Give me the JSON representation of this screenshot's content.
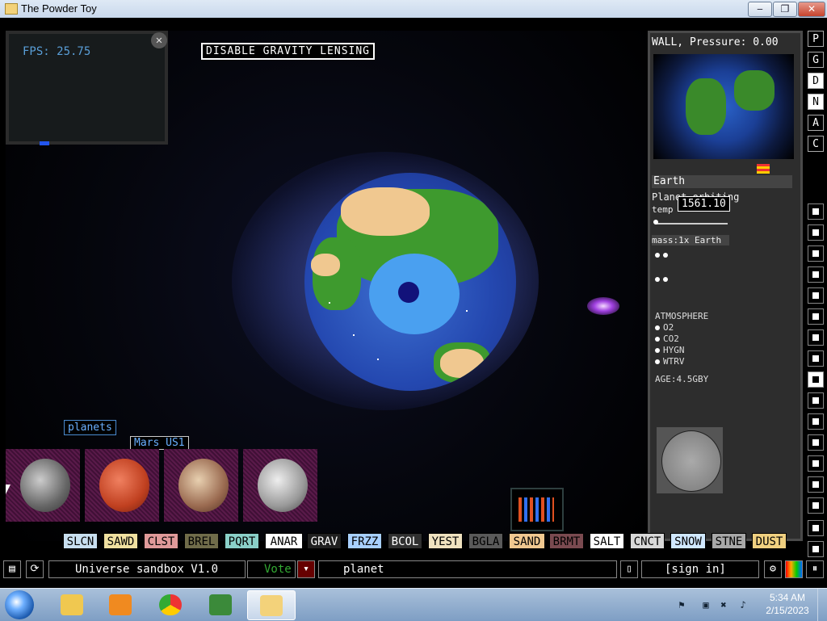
{
  "window": {
    "title": "The Powder Toy",
    "min": "‒",
    "max": "❐",
    "close": "✕"
  },
  "canvas": {
    "fps": "FPS: 25.75",
    "fps_close": "✕",
    "lensing_button": "DISABLE GRAVITY LENSING",
    "planets_label": "planets",
    "hover_label": "Mars US1"
  },
  "properties": {
    "wall_label": "WALL, Pressure: 0.00",
    "name": "Earth",
    "orbiting": "Planet orbiting",
    "temp_prefix": "temp",
    "temp_value": "1561.10",
    "mass": "mass:1x Earth",
    "atmosphere_header": "ATMOSPHERE",
    "atmosphere": [
      "O2",
      "CO2",
      "HYGN",
      "WTRV"
    ],
    "age": "AGE:4.5GBY"
  },
  "rail": {
    "top": [
      "P",
      "G",
      "D",
      "N",
      "A",
      "C"
    ],
    "active": "D",
    "icons": [
      "menu-icon",
      "plug-icon",
      "power-icon",
      "explosive-icon",
      "arrows-icon",
      "brush-icon",
      "pen-icon",
      "drop-icon",
      "flask-icon",
      "square-icon",
      "radiation-icon",
      "star-icon",
      "dots-icon",
      "bulb-icon",
      "bookmark-icon",
      "tools-icon",
      "search-icon",
      "pause-icon"
    ]
  },
  "elements": [
    {
      "label": "SLCN",
      "bg": "#c8dff0",
      "fg": "#000"
    },
    {
      "label": "SAWD",
      "bg": "#f0e0a0",
      "fg": "#000"
    },
    {
      "label": "CLST",
      "bg": "#e09a9a",
      "fg": "#000"
    },
    {
      "label": "BREL",
      "bg": "#706c4a",
      "fg": "#000"
    },
    {
      "label": "PQRT",
      "bg": "#8ad0c8",
      "fg": "#000"
    },
    {
      "label": "ANAR",
      "bg": "#ffffff",
      "fg": "#000"
    },
    {
      "label": "GRAV",
      "bg": "#202020",
      "fg": "#fff"
    },
    {
      "label": "FRZZ",
      "bg": "#a8d0ff",
      "fg": "#000"
    },
    {
      "label": "BCOL",
      "bg": "#303030",
      "fg": "#fff"
    },
    {
      "label": "YEST",
      "bg": "#f0e2c0",
      "fg": "#000"
    },
    {
      "label": "BGLA",
      "bg": "#5a5a5a",
      "fg": "#000"
    },
    {
      "label": "SAND",
      "bg": "#f0c890",
      "fg": "#000"
    },
    {
      "label": "BRMT",
      "bg": "#7a4a50",
      "fg": "#000"
    },
    {
      "label": "SALT",
      "bg": "#ffffff",
      "fg": "#000"
    },
    {
      "label": "CNCT",
      "bg": "#d8d8d8",
      "fg": "#000"
    },
    {
      "label": "SNOW",
      "bg": "#d0e8ff",
      "fg": "#000"
    },
    {
      "label": "STNE",
      "bg": "#a8a8a8",
      "fg": "#000"
    },
    {
      "label": "DUST",
      "bg": "#f0d080",
      "fg": "#000"
    }
  ],
  "bottombar": {
    "save_name": "Universe sandbox V1.0",
    "vote": "Vote",
    "tag": "planet",
    "sign_in": "[sign in]"
  },
  "taskbar": {
    "time": "5:34 AM",
    "date": "2/15/2023"
  }
}
